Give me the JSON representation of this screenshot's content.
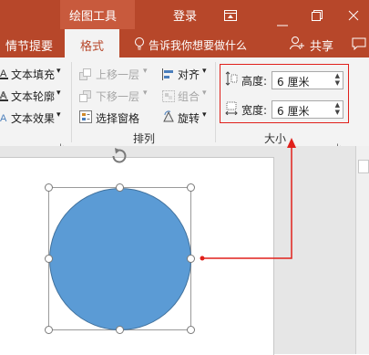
{
  "titlebar": {
    "context_tab": "绘图工具",
    "login": "登录",
    "icons": [
      "restore-ribbon-icon",
      "minimize-icon",
      "restore-icon",
      "close-icon"
    ]
  },
  "tabs": {
    "left_tab": "情节提要",
    "active_tab": "格式",
    "tell_me": "告诉我你想要做什么",
    "share": "共享"
  },
  "ribbon": {
    "text_group": {
      "fill": "文本填充",
      "outline": "文本轮廓",
      "effects": "文本效果"
    },
    "arrange": {
      "bring_forward": "上移一层",
      "send_backward": "下移一层",
      "selection_pane": "选择窗格",
      "align": "对齐",
      "group": "组合",
      "rotate": "旋转",
      "label": "排列"
    },
    "size": {
      "height_label": "高度:",
      "height_value": "6 厘米",
      "width_label": "宽度:",
      "width_value": "6 厘米",
      "label": "大小"
    }
  },
  "colors": {
    "accent": "#b7472a",
    "shape_fill": "#5b9bd5",
    "annotation": "#e0201b"
  }
}
